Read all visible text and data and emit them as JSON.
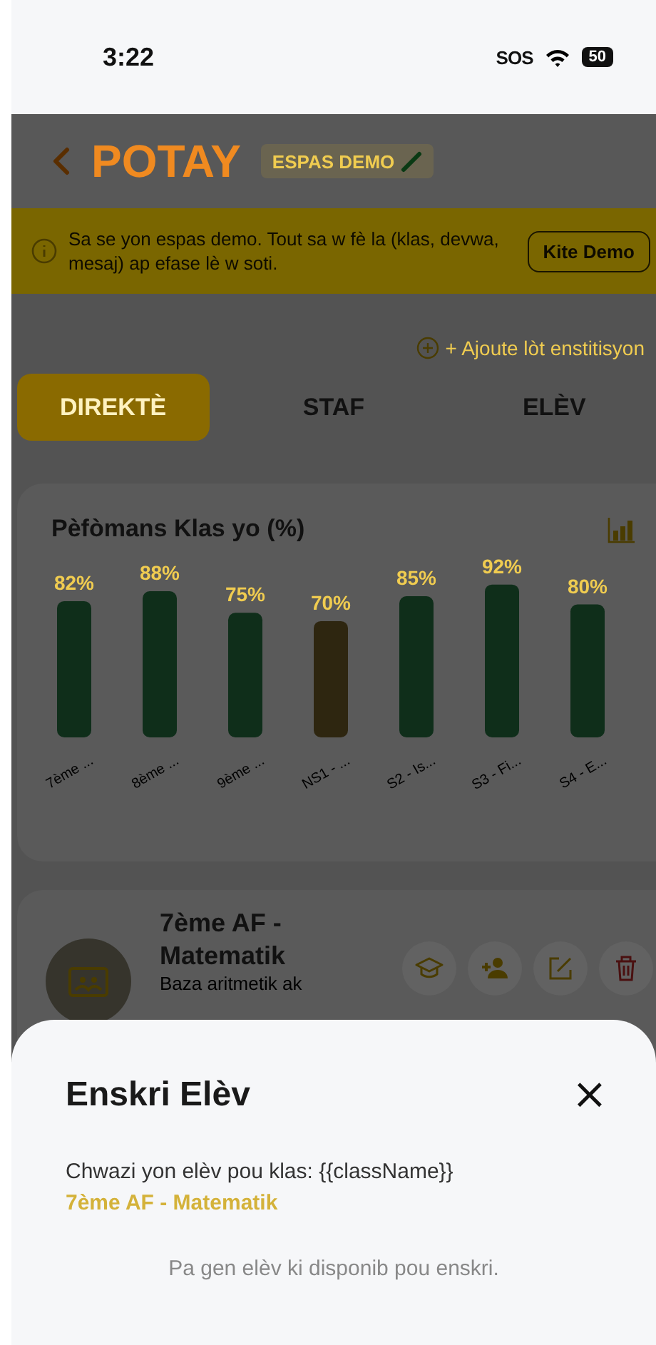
{
  "status_bar": {
    "time": "3:22",
    "sos": "SOS",
    "battery": "50"
  },
  "header": {
    "title": "POTAY",
    "badge": "ESPAS DEMO"
  },
  "demo_banner": {
    "message": "Sa se yon espas demo. Tout sa w fè la (klas, devwa, mesaj) ap efase lè w soti.",
    "button": "Kite Demo"
  },
  "add_institution": "+ Ajoute lòt enstitisyon",
  "tabs": [
    {
      "label": "DIREKTÈ",
      "selected": true
    },
    {
      "label": "STAF",
      "selected": false
    },
    {
      "label": "ELÈV",
      "selected": false
    }
  ],
  "performance_card": {
    "title": "Pèfòmans Klas yo (%)",
    "chart_data": {
      "type": "bar",
      "categories": [
        "7ème ...",
        "8ème ...",
        "9ème ...",
        "NS1 - ...",
        "S2 - Is...",
        "S3 - Fi...",
        "S4 - E..."
      ],
      "stacked": true,
      "series": [
        {
          "color": "#0f2e1a",
          "values": [
            82,
            88,
            75,
            null,
            85,
            92,
            80
          ],
          "value_labels": [
            "82%",
            "88%",
            "75%",
            null,
            "85%",
            "92%",
            "80%"
          ]
        },
        {
          "color": "#2e2610",
          "values": [
            null,
            null,
            null,
            70,
            null,
            null,
            null
          ],
          "value_labels": [
            null,
            null,
            null,
            "70%",
            null,
            null,
            null
          ]
        }
      ]
    }
  },
  "class_card": {
    "title": "7ème AF - Matematik",
    "subtitle": "Baza aritmetik ak"
  },
  "sheet": {
    "title": "Enskri Elèv",
    "close": "×",
    "prompt": "Chwazi yon elèv pou klas: {{className}}",
    "class_name": "7ème AF - Matematik",
    "empty_message": "Pa gen elèv ki disponib pou enskri."
  }
}
